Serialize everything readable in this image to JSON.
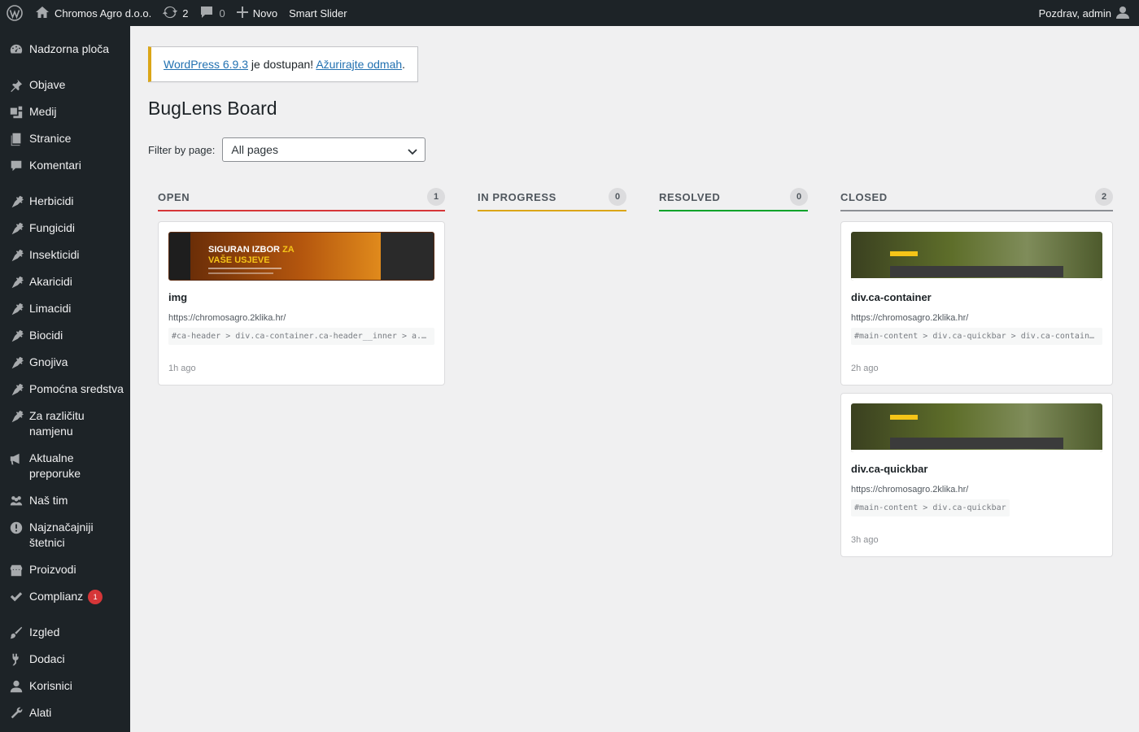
{
  "adminbar": {
    "site_name": "Chromos Agro d.o.o.",
    "updates_count": "2",
    "comments_count": "0",
    "new_label": "Novo",
    "smart_slider": "Smart Slider",
    "greeting": "Pozdrav, admin"
  },
  "sidebar": {
    "items": [
      {
        "label": "Nadzorna ploča",
        "icon": "dashboard-icon"
      },
      {
        "label": "Objave",
        "icon": "pin-icon"
      },
      {
        "label": "Medij",
        "icon": "media-icon"
      },
      {
        "label": "Stranice",
        "icon": "pages-icon"
      },
      {
        "label": "Komentari",
        "icon": "comment-icon"
      },
      {
        "label": "Herbicidi",
        "icon": "carrot-icon"
      },
      {
        "label": "Fungicidi",
        "icon": "carrot-icon"
      },
      {
        "label": "Insekticidi",
        "icon": "carrot-icon"
      },
      {
        "label": "Akaricidi",
        "icon": "carrot-icon"
      },
      {
        "label": "Limacidi",
        "icon": "carrot-icon"
      },
      {
        "label": "Biocidi",
        "icon": "carrot-icon"
      },
      {
        "label": "Gnojiva",
        "icon": "carrot-icon"
      },
      {
        "label": "Pomoćna sredstva",
        "icon": "carrot-icon"
      },
      {
        "label": "Za različitu namjenu",
        "icon": "carrot-icon"
      },
      {
        "label": "Aktualne preporuke",
        "icon": "megaphone-icon"
      },
      {
        "label": "Naš tim",
        "icon": "groups-icon"
      },
      {
        "label": "Najznačajniji štetnici",
        "icon": "warning-icon"
      },
      {
        "label": "Proizvodi",
        "icon": "store-icon"
      },
      {
        "label": "Complianz",
        "icon": "check-icon",
        "badge": "1"
      },
      {
        "label": "Izgled",
        "icon": "brush-icon"
      },
      {
        "label": "Dodaci",
        "icon": "plugin-icon"
      },
      {
        "label": "Korisnici",
        "icon": "user-icon"
      },
      {
        "label": "Alati",
        "icon": "wrench-icon"
      }
    ]
  },
  "notice": {
    "link1": "WordPress 6.9.3",
    "middle": " je dostupan! ",
    "link2": "Ažurirajte odmah",
    "end": "."
  },
  "page": {
    "title": "BugLens Board",
    "filter_label": "Filter by page:",
    "filter_value": "All pages"
  },
  "board": {
    "columns": [
      {
        "title": "OPEN",
        "count": "1",
        "color": "#d63638",
        "cards": [
          {
            "title": "img",
            "url": "https://chromosagro.2klika.hr/",
            "selector": "#ca-header > div.ca-container.ca-header__inner > a...",
            "time": "1h ago",
            "thumb_line1": "SIGURAN IZBOR",
            "thumb_line1b": "ZA",
            "thumb_line2": "VAŠE USJEVE"
          }
        ]
      },
      {
        "title": "IN PROGRESS",
        "count": "0",
        "color": "#dba617",
        "cards": []
      },
      {
        "title": "RESOLVED",
        "count": "0",
        "color": "#00a32a",
        "cards": []
      },
      {
        "title": "CLOSED",
        "count": "2",
        "color": "#8c8f94",
        "cards": [
          {
            "title": "div.ca-container",
            "url": "https://chromosagro.2klika.hr/",
            "selector": "#main-content > div.ca-quickbar > div.ca-container",
            "time": "2h ago"
          },
          {
            "title": "div.ca-quickbar",
            "url": "https://chromosagro.2klika.hr/",
            "selector": "#main-content > div.ca-quickbar",
            "time": "3h ago"
          }
        ]
      }
    ]
  }
}
